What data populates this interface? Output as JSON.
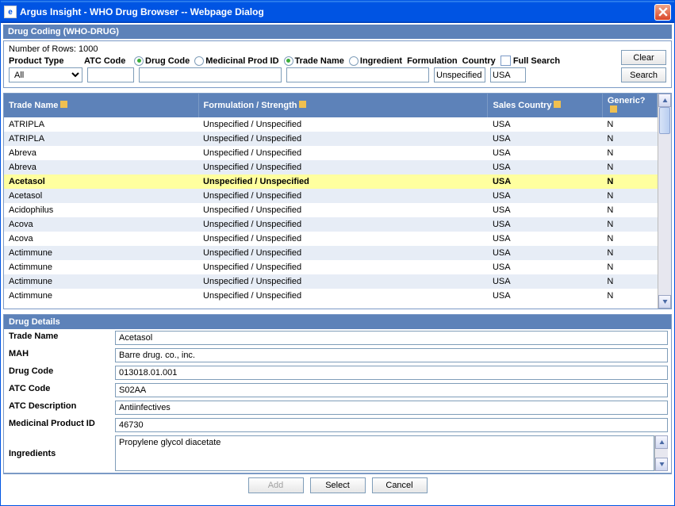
{
  "window": {
    "title": "Argus Insight - WHO Drug Browser -- Webpage Dialog"
  },
  "header": {
    "label": "Drug Coding (WHO-DRUG)"
  },
  "search": {
    "rows_label": "Number of Rows: 1000",
    "product_type_label": "Product Type",
    "atc_label": "ATC Code",
    "drug_code_label": "Drug Code",
    "medicinal_label": "Medicinal Prod ID",
    "trade_name_label": "Trade Name",
    "ingredient_label": "Ingredient",
    "formulation_label": "Formulation",
    "country_label": "Country",
    "full_search_label": "Full Search",
    "product_type_value": "All",
    "formulation_value": "Unspecified",
    "country_value": "USA",
    "clear_btn": "Clear",
    "search_btn": "Search"
  },
  "grid": {
    "headers": {
      "trade": "Trade Name",
      "formulation": "Formulation / Strength",
      "country": "Sales Country",
      "generic": "Generic?"
    },
    "rows": [
      {
        "trade": "ATRIPLA",
        "form": "Unspecified / Unspecified",
        "country": "USA",
        "gen": "N"
      },
      {
        "trade": "ATRIPLA",
        "form": "Unspecified / Unspecified",
        "country": "USA",
        "gen": "N"
      },
      {
        "trade": "Abreva",
        "form": "Unspecified / Unspecified",
        "country": "USA",
        "gen": "N"
      },
      {
        "trade": "Abreva",
        "form": "Unspecified / Unspecified",
        "country": "USA",
        "gen": "N"
      },
      {
        "trade": "Acetasol",
        "form": "Unspecified / Unspecified",
        "country": "USA",
        "gen": "N"
      },
      {
        "trade": "Acetasol",
        "form": "Unspecified / Unspecified",
        "country": "USA",
        "gen": "N"
      },
      {
        "trade": "Acidophilus",
        "form": "Unspecified / Unspecified",
        "country": "USA",
        "gen": "N"
      },
      {
        "trade": "Acova",
        "form": "Unspecified / Unspecified",
        "country": "USA",
        "gen": "N"
      },
      {
        "trade": "Acova",
        "form": "Unspecified / Unspecified",
        "country": "USA",
        "gen": "N"
      },
      {
        "trade": "Actimmune",
        "form": "Unspecified / Unspecified",
        "country": "USA",
        "gen": "N"
      },
      {
        "trade": "Actimmune",
        "form": "Unspecified / Unspecified",
        "country": "USA",
        "gen": "N"
      },
      {
        "trade": "Actimmune",
        "form": "Unspecified / Unspecified",
        "country": "USA",
        "gen": "N"
      },
      {
        "trade": "Actimmune",
        "form": "Unspecified / Unspecified",
        "country": "USA",
        "gen": "N"
      }
    ],
    "selected_index": 4
  },
  "details": {
    "header": "Drug Details",
    "trade_label": "Trade Name",
    "trade": "Acetasol",
    "mah_label": "MAH",
    "mah": "Barre drug. co., inc.",
    "drugcode_label": "Drug Code",
    "drugcode": "013018.01.001",
    "atc_label": "ATC Code",
    "atc": "S02AA",
    "atcdesc_label": "ATC Description",
    "atcdesc": "Antiinfectives",
    "medid_label": "Medicinal Product ID",
    "medid": "46730",
    "ing_label": "Ingredients",
    "ing": "Propylene glycol diacetate"
  },
  "footer": {
    "add": "Add",
    "select": "Select",
    "cancel": "Cancel"
  }
}
